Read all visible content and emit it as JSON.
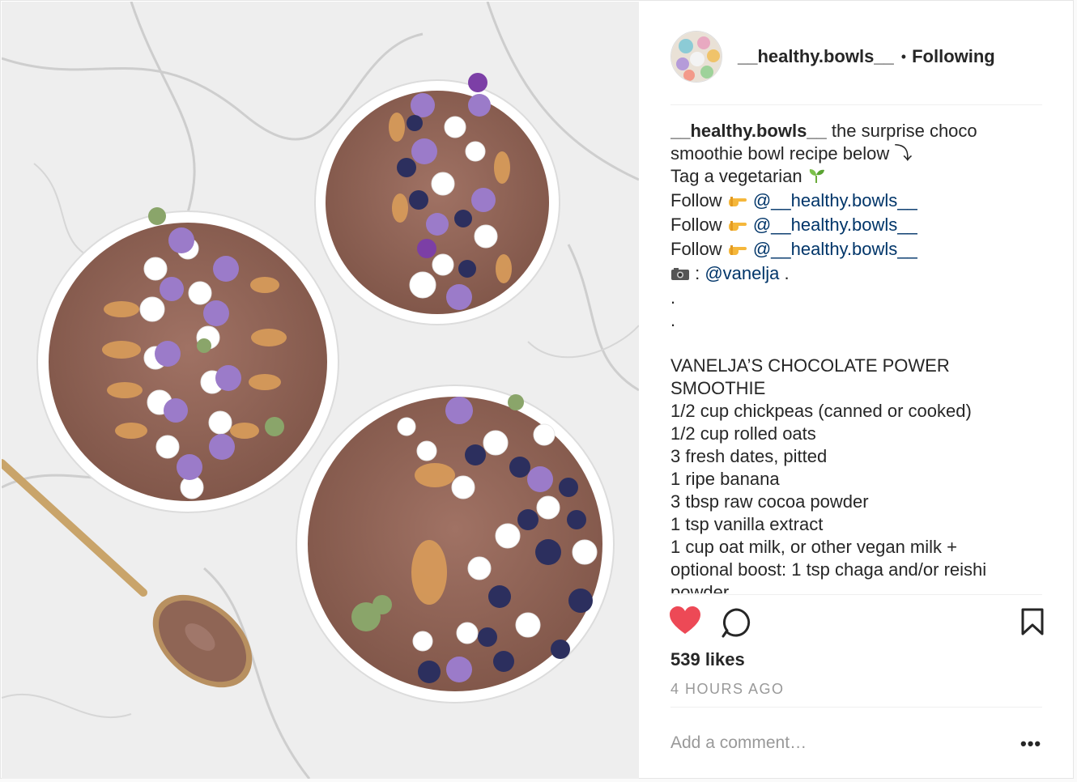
{
  "post": {
    "username": "__healthy.bowls__",
    "separator": "•",
    "follow_status": "Following"
  },
  "caption": {
    "username": "__healthy.bowls__",
    "line1_text": " the surprise choco",
    "line2": "smoothie bowl recipe below ⤵︎",
    "line3": "Tag a vegetarian ",
    "follow_label": "Follow ",
    "mention_account": "@__healthy.bowls__",
    "camera_sep": " : ",
    "photo_credit": "@vanelja",
    "credit_end": " .",
    "dot": ".",
    "recipe_title_1": "VANELJA’S CHOCOLATE POWER",
    "recipe_title_2": "SMOOTHIE",
    "ingredients": [
      "1/2 cup chickpeas (canned or cooked)",
      "1/2 cup rolled oats",
      "3 fresh dates, pitted",
      "1 ripe banana",
      "3 tbsp raw cocoa powder",
      "1 tsp vanilla extract",
      "1 cup oat milk, or other vegan milk +",
      "optional boost: 1 tsp chaga and/or reishi",
      "powder"
    ]
  },
  "stats": {
    "likes": "539 likes",
    "time": "4 HOURS AGO"
  },
  "comment_box": {
    "placeholder": "Add a comment…",
    "more": "•••"
  },
  "icons": {
    "heart": "heart-icon",
    "comment": "comment-icon",
    "bookmark": "bookmark-icon",
    "camera": "camera-icon",
    "point": "pointing-hand-icon",
    "seedling": "seedling-icon"
  },
  "colors": {
    "like_red": "#ed4956",
    "mention_blue": "#003569",
    "muted": "#999999"
  }
}
